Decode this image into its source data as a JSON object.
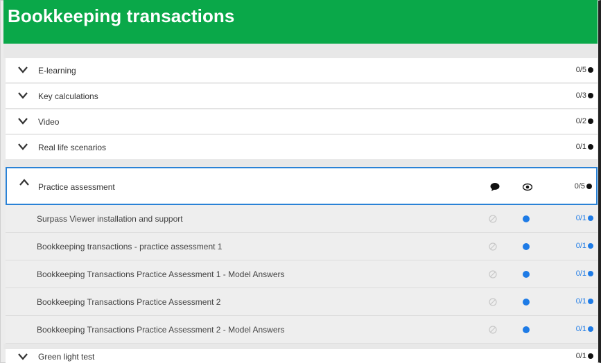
{
  "header": {
    "title": "Bookkeeping transactions"
  },
  "sections": [
    {
      "label": "E-learning",
      "count": "0/5"
    },
    {
      "label": "Key calculations",
      "count": "0/3"
    },
    {
      "label": "Video",
      "count": "0/2"
    },
    {
      "label": "Real life scenarios",
      "count": "0/1"
    }
  ],
  "practice": {
    "label": "Practice assessment",
    "count": "0/5",
    "items": [
      {
        "label": "Surpass Viewer installation and support",
        "count": "0/1"
      },
      {
        "label": "Bookkeeping transactions - practice assessment 1",
        "count": "0/1"
      },
      {
        "label": "Bookkeeping Transactions Practice Assessment 1 - Model Answers",
        "count": "0/1"
      },
      {
        "label": "Bookkeeping Transactions Practice Assessment 2",
        "count": "0/1"
      },
      {
        "label": "Bookkeeping Transactions Practice Assessment 2 - Model Answers",
        "count": "0/1"
      }
    ]
  },
  "last_section": {
    "label": "Green light test",
    "count": "0/1"
  },
  "icons": {
    "chevron": "chevron-down-icon",
    "chevron_up": "chevron-up-icon",
    "comment": "comment-icon",
    "eye": "eye-icon",
    "blocked": "blocked-icon",
    "status": "status-dot-icon"
  },
  "colors": {
    "header": "#0aa849",
    "accent": "#1e7be6",
    "border_active": "#2a82d6"
  }
}
